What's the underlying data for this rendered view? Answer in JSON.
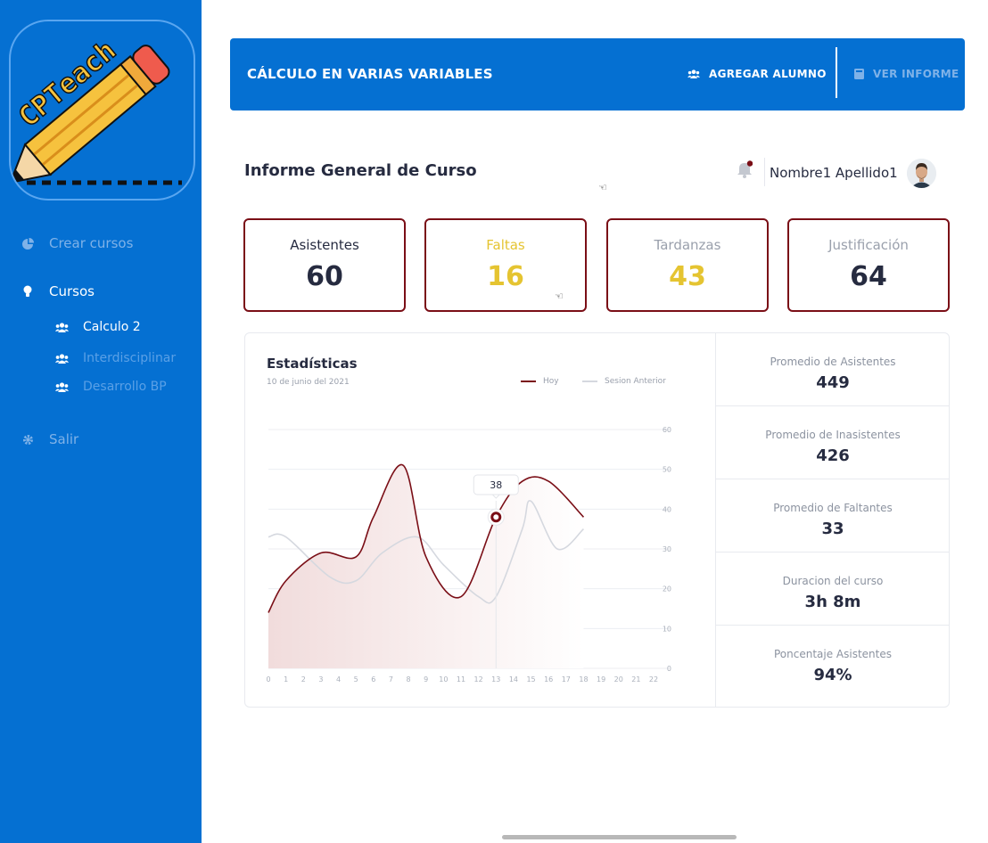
{
  "app": {
    "logo_text": "CPTeach"
  },
  "sidebar": {
    "items": [
      {
        "label": "Crear cursos",
        "icon": "pie-chart-icon"
      },
      {
        "label": "Cursos",
        "icon": "lightbulb-icon"
      },
      {
        "label": "Salir",
        "icon": "gear-icon"
      }
    ],
    "courses": [
      {
        "label": "Calculo 2",
        "icon": "users-icon"
      },
      {
        "label": "Interdisciplinar",
        "icon": "users-icon"
      },
      {
        "label": "Desarrollo BP",
        "icon": "users-icon"
      }
    ]
  },
  "topbar": {
    "title": "CÁLCULO EN VARIAS VARIABLES",
    "add_student_label": "AGREGAR ALUMNO",
    "view_report_label": "VER INFORME"
  },
  "header": {
    "title": "Informe General de Curso",
    "user_name": "Nombre1 Apellido1"
  },
  "stats": [
    {
      "label": "Asistentes",
      "value": "60",
      "color": "#262b40",
      "label_color": "#262b40"
    },
    {
      "label": "Faltas",
      "value": "16",
      "color": "#e5c431",
      "label_color": "#e5c431"
    },
    {
      "label": "Tardanzas",
      "value": "43",
      "color": "#e5c431",
      "label_color": "#9aa0ac"
    },
    {
      "label": "Justificación",
      "value": "64",
      "color": "#262b40",
      "label_color": "#9aa0ac"
    }
  ],
  "chart": {
    "title": "Estadísticas",
    "date": "10 de junio del 2021",
    "tooltip_value": "38"
  },
  "chart_data": {
    "type": "area",
    "x": [
      0,
      1,
      2,
      3,
      4,
      5,
      6,
      7,
      8,
      9,
      10,
      11,
      12,
      13,
      14,
      15,
      16,
      17,
      18,
      19,
      20,
      21,
      22
    ],
    "xlim": [
      0,
      22
    ],
    "ylim": [
      0,
      60
    ],
    "yticks": [
      0,
      10,
      20,
      30,
      40,
      50,
      60
    ],
    "grid": true,
    "legend_position": "top-right",
    "colors": {
      "hoy": "#7a0e16",
      "sesion_anterior": "#d5d8df"
    },
    "series": [
      {
        "name": "Hoy",
        "x": [
          0,
          1,
          3,
          5,
          6,
          7.7,
          9,
          11,
          13,
          14.5,
          16,
          18
        ],
        "values": [
          14,
          22,
          29,
          28,
          38,
          51,
          28,
          18,
          38,
          47,
          47,
          38
        ]
      },
      {
        "name": "Sesion Anterior",
        "x": [
          0,
          1,
          3.5,
          5,
          6.5,
          8.5,
          10,
          12,
          13,
          14.5,
          15,
          16.5,
          18
        ],
        "values": [
          33,
          33,
          23,
          22,
          29,
          33,
          26,
          18,
          18,
          35,
          42,
          30,
          35
        ]
      }
    ],
    "highlight": {
      "x": 13,
      "y": 38,
      "label": "38"
    }
  },
  "metrics": [
    {
      "label": "Promedio de Asistentes",
      "value": "449"
    },
    {
      "label": "Promedio de Inasistentes",
      "value": "426"
    },
    {
      "label": "Promedio de Faltantes",
      "value": "33"
    },
    {
      "label": "Duracion del curso",
      "value": "3h 8m"
    },
    {
      "label": "Poncentaje Asistentes",
      "value": "94%"
    }
  ]
}
